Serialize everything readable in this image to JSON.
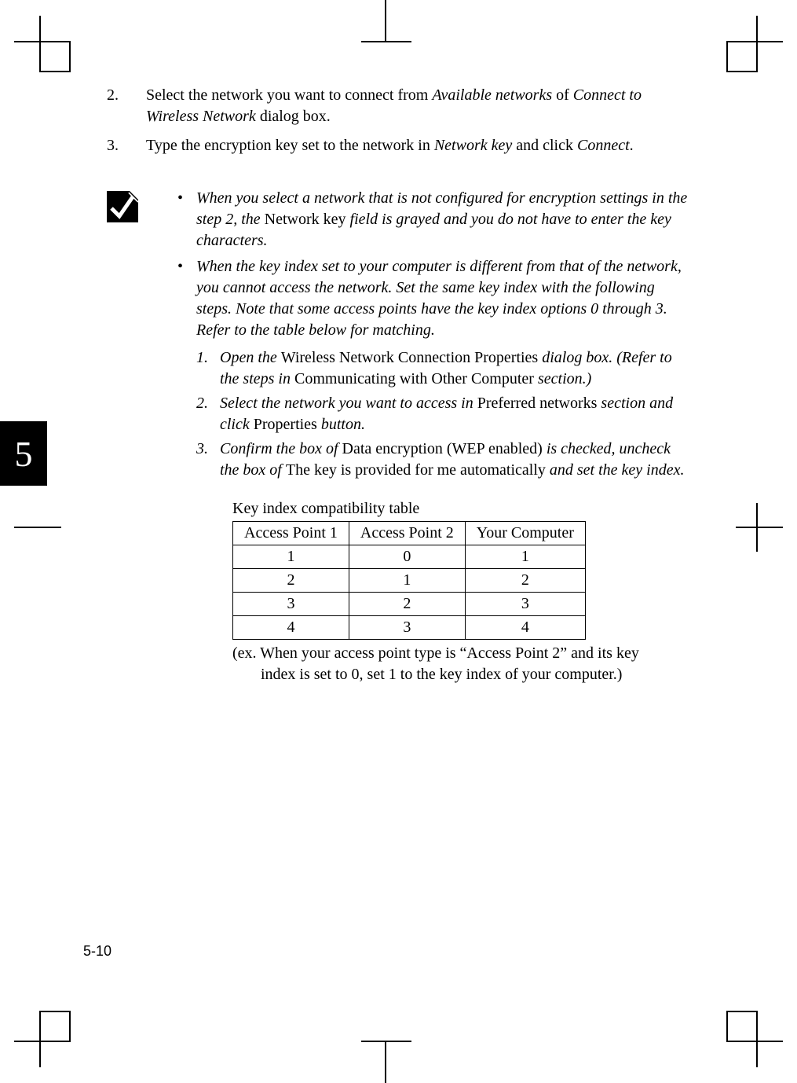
{
  "chapter_tab": "5",
  "page_number": "5-10",
  "steps": [
    {
      "num": "2.",
      "pre": "Select the network you want to connect from ",
      "i1": "Available networks",
      "mid": " of ",
      "i2": "Connect to Wireless Network",
      "post": " dialog box."
    },
    {
      "num": "3.",
      "pre": "Type the encryption key set to the network in ",
      "i1": "Network key",
      "mid": " and click ",
      "i2": "Connect",
      "post": "."
    }
  ],
  "note_bullets": [
    {
      "i_pre": "When you select a network that is not configured for encryption settings in the step 2, the ",
      "plain_mid": "Network key",
      "i_post": " field is grayed and you do not have to enter the key characters."
    },
    {
      "i_full": "When the key index set to your computer is different from that of the network, you cannot access the network. Set the same key index with the following steps. Note that some access points have the key index options 0 through 3. Refer to the table below for matching."
    }
  ],
  "sub_steps": [
    {
      "n": "1.",
      "i_pre": " Open the ",
      "plain1": "Wireless Network Connection Properties",
      "i_mid": " dialog box. (Refer to the steps in ",
      "plain2": "Communicating with Other Computer",
      "i_post": "  section.)"
    },
    {
      "n": "2.",
      "i_pre": "Select the network you want to access in ",
      "plain1": "Preferred networks",
      "i_mid": " section and click ",
      "plain2": "Properties",
      "i_post": " button."
    },
    {
      "n": "3.",
      "i_pre": "Confirm the box of ",
      "plain1": "Data encryption (WEP enabled)",
      "i_mid": " is checked, uncheck the box of ",
      "plain2": "The key is provided for me automatically",
      "i_post": " and set the key index."
    }
  ],
  "table": {
    "caption": "Key index compatibility table",
    "headers": [
      "Access Point 1",
      "Access Point 2",
      "Your Computer"
    ],
    "rows": [
      [
        "1",
        "0",
        "1"
      ],
      [
        "2",
        "1",
        "2"
      ],
      [
        "3",
        "2",
        "3"
      ],
      [
        "4",
        "3",
        "4"
      ]
    ]
  },
  "example_line1": "(ex. When your access point type is “Access Point 2” and its key",
  "example_line2": "index is set to 0, set 1 to the key index of your computer.)"
}
